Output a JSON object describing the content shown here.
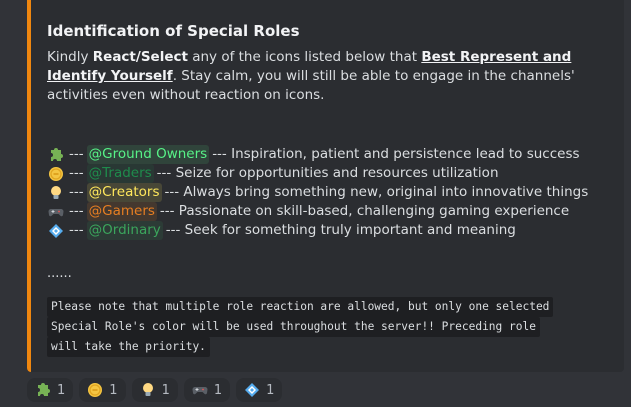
{
  "embed": {
    "accent_color": "#f0870f",
    "title": "Identification of Special Roles",
    "desc": {
      "p1": "Kindly ",
      "b1": "React/Select",
      "p2": " any of the icons listed below that ",
      "u1": "Best Represent and Identify Yourself",
      "p3": ". Stay calm, you will still be able to engage in the channels' activities even without reaction on icons."
    },
    "roles": [
      {
        "icon": "puzzle-icon",
        "sep": " --- ",
        "mention": "@Ground Owners",
        "mention_color": "#57f287",
        "mention_bg": "rgba(87,242,135,0.12)",
        "text": " --- Inspiration, patient and persistence lead to success"
      },
      {
        "icon": "coin-icon",
        "sep": " --- ",
        "mention": "@Traders",
        "mention_color": "#1f8b4c",
        "mention_bg": "rgba(31,139,76,0.12)",
        "text": " --- Seize for opportunities and resources utilization"
      },
      {
        "icon": "lightbulb-icon",
        "sep": " --- ",
        "mention": "@Creators",
        "mention_color": "#fee75c",
        "mention_bg": "rgba(254,231,92,0.14)",
        "text": " --- Always bring something new, original into innovative things"
      },
      {
        "icon": "gamepad-icon",
        "sep": " --- ",
        "mention": "@Gamers",
        "mention_color": "#e67e22",
        "mention_bg": "rgba(230,126,34,0.14)",
        "text": " --- Passionate on skill-based, challenging gaming experience"
      },
      {
        "icon": "diamond-icon",
        "sep": " --- ",
        "mention": "@Ordinary",
        "mention_color": "#3ba55c",
        "mention_bg": "rgba(59,165,92,0.12)",
        "text": " --- Seek for something truly important and meaning"
      }
    ],
    "ellipsis": "......",
    "code_lines": [
      "Please note that multiple role reaction are allowed, but only one selected",
      "Special Role's color will be used throughout the server!! Preceding role",
      "will take the priority."
    ]
  },
  "reactions": [
    {
      "icon": "puzzle-icon",
      "count": "1"
    },
    {
      "icon": "coin-icon",
      "count": "1"
    },
    {
      "icon": "lightbulb-icon",
      "count": "1"
    },
    {
      "icon": "gamepad-icon",
      "count": "1"
    },
    {
      "icon": "diamond-icon",
      "count": "1"
    }
  ]
}
